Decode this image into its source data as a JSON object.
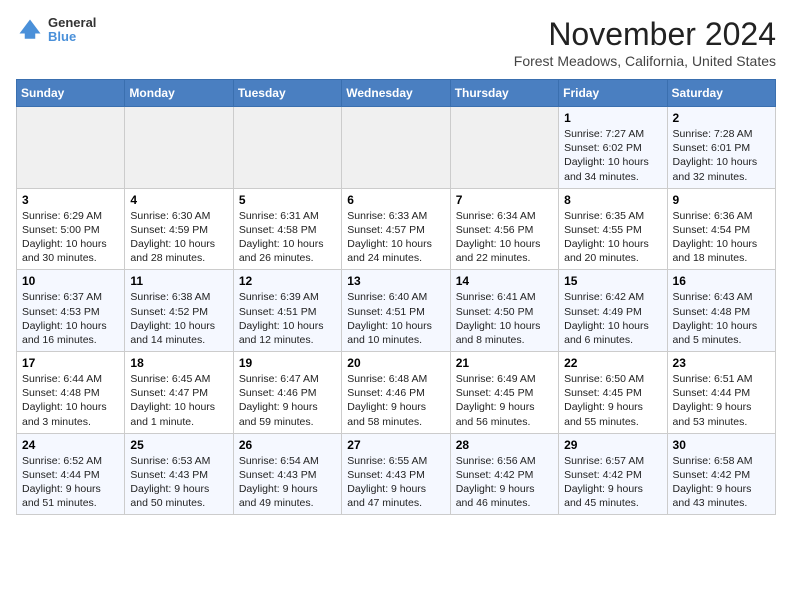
{
  "logo": {
    "general": "General",
    "blue": "Blue"
  },
  "title": "November 2024",
  "location": "Forest Meadows, California, United States",
  "weekdays": [
    "Sunday",
    "Monday",
    "Tuesday",
    "Wednesday",
    "Thursday",
    "Friday",
    "Saturday"
  ],
  "weeks": [
    [
      {
        "day": "",
        "content": ""
      },
      {
        "day": "",
        "content": ""
      },
      {
        "day": "",
        "content": ""
      },
      {
        "day": "",
        "content": ""
      },
      {
        "day": "",
        "content": ""
      },
      {
        "day": "1",
        "content": "Sunrise: 7:27 AM\nSunset: 6:02 PM\nDaylight: 10 hours\nand 34 minutes."
      },
      {
        "day": "2",
        "content": "Sunrise: 7:28 AM\nSunset: 6:01 PM\nDaylight: 10 hours\nand 32 minutes."
      }
    ],
    [
      {
        "day": "3",
        "content": "Sunrise: 6:29 AM\nSunset: 5:00 PM\nDaylight: 10 hours\nand 30 minutes."
      },
      {
        "day": "4",
        "content": "Sunrise: 6:30 AM\nSunset: 4:59 PM\nDaylight: 10 hours\nand 28 minutes."
      },
      {
        "day": "5",
        "content": "Sunrise: 6:31 AM\nSunset: 4:58 PM\nDaylight: 10 hours\nand 26 minutes."
      },
      {
        "day": "6",
        "content": "Sunrise: 6:33 AM\nSunset: 4:57 PM\nDaylight: 10 hours\nand 24 minutes."
      },
      {
        "day": "7",
        "content": "Sunrise: 6:34 AM\nSunset: 4:56 PM\nDaylight: 10 hours\nand 22 minutes."
      },
      {
        "day": "8",
        "content": "Sunrise: 6:35 AM\nSunset: 4:55 PM\nDaylight: 10 hours\nand 20 minutes."
      },
      {
        "day": "9",
        "content": "Sunrise: 6:36 AM\nSunset: 4:54 PM\nDaylight: 10 hours\nand 18 minutes."
      }
    ],
    [
      {
        "day": "10",
        "content": "Sunrise: 6:37 AM\nSunset: 4:53 PM\nDaylight: 10 hours\nand 16 minutes."
      },
      {
        "day": "11",
        "content": "Sunrise: 6:38 AM\nSunset: 4:52 PM\nDaylight: 10 hours\nand 14 minutes."
      },
      {
        "day": "12",
        "content": "Sunrise: 6:39 AM\nSunset: 4:51 PM\nDaylight: 10 hours\nand 12 minutes."
      },
      {
        "day": "13",
        "content": "Sunrise: 6:40 AM\nSunset: 4:51 PM\nDaylight: 10 hours\nand 10 minutes."
      },
      {
        "day": "14",
        "content": "Sunrise: 6:41 AM\nSunset: 4:50 PM\nDaylight: 10 hours\nand 8 minutes."
      },
      {
        "day": "15",
        "content": "Sunrise: 6:42 AM\nSunset: 4:49 PM\nDaylight: 10 hours\nand 6 minutes."
      },
      {
        "day": "16",
        "content": "Sunrise: 6:43 AM\nSunset: 4:48 PM\nDaylight: 10 hours\nand 5 minutes."
      }
    ],
    [
      {
        "day": "17",
        "content": "Sunrise: 6:44 AM\nSunset: 4:48 PM\nDaylight: 10 hours\nand 3 minutes."
      },
      {
        "day": "18",
        "content": "Sunrise: 6:45 AM\nSunset: 4:47 PM\nDaylight: 10 hours\nand 1 minute."
      },
      {
        "day": "19",
        "content": "Sunrise: 6:47 AM\nSunset: 4:46 PM\nDaylight: 9 hours\nand 59 minutes."
      },
      {
        "day": "20",
        "content": "Sunrise: 6:48 AM\nSunset: 4:46 PM\nDaylight: 9 hours\nand 58 minutes."
      },
      {
        "day": "21",
        "content": "Sunrise: 6:49 AM\nSunset: 4:45 PM\nDaylight: 9 hours\nand 56 minutes."
      },
      {
        "day": "22",
        "content": "Sunrise: 6:50 AM\nSunset: 4:45 PM\nDaylight: 9 hours\nand 55 minutes."
      },
      {
        "day": "23",
        "content": "Sunrise: 6:51 AM\nSunset: 4:44 PM\nDaylight: 9 hours\nand 53 minutes."
      }
    ],
    [
      {
        "day": "24",
        "content": "Sunrise: 6:52 AM\nSunset: 4:44 PM\nDaylight: 9 hours\nand 51 minutes."
      },
      {
        "day": "25",
        "content": "Sunrise: 6:53 AM\nSunset: 4:43 PM\nDaylight: 9 hours\nand 50 minutes."
      },
      {
        "day": "26",
        "content": "Sunrise: 6:54 AM\nSunset: 4:43 PM\nDaylight: 9 hours\nand 49 minutes."
      },
      {
        "day": "27",
        "content": "Sunrise: 6:55 AM\nSunset: 4:43 PM\nDaylight: 9 hours\nand 47 minutes."
      },
      {
        "day": "28",
        "content": "Sunrise: 6:56 AM\nSunset: 4:42 PM\nDaylight: 9 hours\nand 46 minutes."
      },
      {
        "day": "29",
        "content": "Sunrise: 6:57 AM\nSunset: 4:42 PM\nDaylight: 9 hours\nand 45 minutes."
      },
      {
        "day": "30",
        "content": "Sunrise: 6:58 AM\nSunset: 4:42 PM\nDaylight: 9 hours\nand 43 minutes."
      }
    ]
  ]
}
